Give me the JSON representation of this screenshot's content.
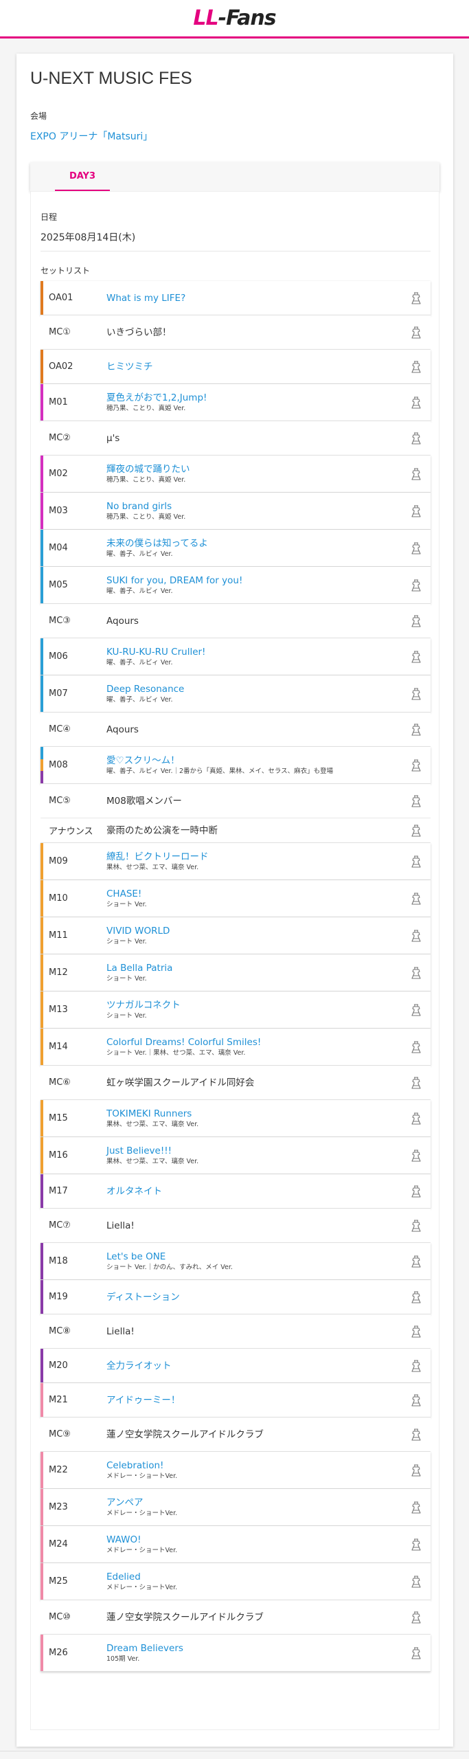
{
  "header": {
    "logo_ll": "LL",
    "logo_rest": "-Fans"
  },
  "event": {
    "title": "U-NEXT MUSIC FES",
    "venue_label": "会場",
    "venue": "EXPO アリーナ「Matsuri」"
  },
  "tabs": [
    {
      "label": "DAY3",
      "active": true
    }
  ],
  "day": {
    "date_label": "日程",
    "date": "2025年08月14日(木)",
    "setlist_label": "セットリスト"
  },
  "colors": {
    "orange": "#e07a1f",
    "magenta": "#d42fbf",
    "blue": "#2a9fd6",
    "amber": "#f0a030",
    "purple": "#8a3aa8",
    "pink": "#f08aa8",
    "link": "#1e90d6",
    "accent": "#e4007f"
  },
  "setlist": [
    {
      "code": "OA01",
      "title": "What is my LIFE?",
      "note": "",
      "link": true,
      "bar": [
        "orange"
      ],
      "h": 50
    },
    {
      "code": "MC①",
      "title": "いきづらい部！",
      "note": "",
      "link": false,
      "bar": [],
      "h": 50
    },
    {
      "code": "OA02",
      "title": "ヒミツミチ",
      "note": "",
      "link": true,
      "bar": [
        "orange"
      ],
      "h": 50
    },
    {
      "code": "M01",
      "title": "夏色えがおで1,2,Jump!",
      "note": "穂乃果、ことり、真姫 Ver.",
      "link": true,
      "bar": [
        "magenta"
      ],
      "h": 54
    },
    {
      "code": "MC②",
      "title": "μ's",
      "note": "",
      "link": false,
      "bar": [],
      "h": 50
    },
    {
      "code": "M02",
      "title": "輝夜の城で踊りたい",
      "note": "穂乃果、ことり、真姫 Ver.",
      "link": true,
      "bar": [
        "magenta"
      ],
      "h": 54
    },
    {
      "code": "M03",
      "title": "No brand girls",
      "note": "穂乃果、ことり、真姫 Ver.",
      "link": true,
      "bar": [
        "magenta"
      ],
      "h": 54
    },
    {
      "code": "M04",
      "title": "未来の僕らは知ってるよ",
      "note": "曜、善子、ルビィ Ver.",
      "link": true,
      "bar": [
        "blue"
      ],
      "h": 54
    },
    {
      "code": "M05",
      "title": "SUKI for you, DREAM for you!",
      "note": "曜、善子、ルビィ Ver.",
      "link": true,
      "bar": [
        "blue"
      ],
      "h": 54
    },
    {
      "code": "MC③",
      "title": "Aqours",
      "note": "",
      "link": false,
      "bar": [],
      "h": 50
    },
    {
      "code": "M06",
      "title": "KU-RU-KU-RU Cruller!",
      "note": "曜、善子、ルビィ Ver.",
      "link": true,
      "bar": [
        "blue"
      ],
      "h": 54
    },
    {
      "code": "M07",
      "title": "Deep Resonance",
      "note": "曜、善子、ルビィ Ver.",
      "link": true,
      "bar": [
        "blue"
      ],
      "h": 54
    },
    {
      "code": "MC④",
      "title": "Aqours",
      "note": "",
      "link": false,
      "bar": [],
      "h": 50
    },
    {
      "code": "M08",
      "title": "愛♡スクリ〜ム！",
      "note": "曜、善子、ルビィ Ver.｜2番から「真姫、果林、メイ、セラス、麻衣」も登場",
      "link": true,
      "bar": [
        "blue",
        "amber",
        "purple"
      ],
      "h": 54
    },
    {
      "code": "MC⑤",
      "title": "M08歌唱メンバー",
      "note": "",
      "link": false,
      "bar": [],
      "h": 50
    },
    {
      "code": "アナウンス",
      "title": "豪雨のため公演を一時中断",
      "note": "",
      "link": false,
      "bar": [],
      "h": 36
    },
    {
      "code": "M09",
      "title": "繚乱！ビクトリーロード",
      "note": "果林、せつ菜、エマ、璃奈 Ver.",
      "link": true,
      "bar": [
        "amber"
      ],
      "h": 54
    },
    {
      "code": "M10",
      "title": "CHASE!",
      "note": "ショート Ver.",
      "link": true,
      "bar": [
        "amber"
      ],
      "h": 54
    },
    {
      "code": "M11",
      "title": "VIVID WORLD",
      "note": "ショート Ver.",
      "link": true,
      "bar": [
        "amber"
      ],
      "h": 54
    },
    {
      "code": "M12",
      "title": "La Bella Patria",
      "note": "ショート Ver.",
      "link": true,
      "bar": [
        "amber"
      ],
      "h": 54
    },
    {
      "code": "M13",
      "title": "ツナガルコネクト",
      "note": "ショート Ver.",
      "link": true,
      "bar": [
        "amber"
      ],
      "h": 54
    },
    {
      "code": "M14",
      "title": "Colorful Dreams! Colorful Smiles!",
      "note": "ショート Ver.｜果林、せつ菜、エマ、璃奈 Ver.",
      "link": true,
      "bar": [
        "amber"
      ],
      "h": 54
    },
    {
      "code": "MC⑥",
      "title": "虹ヶ咲学園スクールアイドル同好会",
      "note": "",
      "link": false,
      "bar": [],
      "h": 50
    },
    {
      "code": "M15",
      "title": "TOKIMEKI Runners",
      "note": "果林、せつ菜、エマ、璃奈 Ver.",
      "link": true,
      "bar": [
        "amber"
      ],
      "h": 54
    },
    {
      "code": "M16",
      "title": "Just Believe!!!",
      "note": "果林、せつ菜、エマ、璃奈 Ver.",
      "link": true,
      "bar": [
        "amber"
      ],
      "h": 54
    },
    {
      "code": "M17",
      "title": "オルタネイト",
      "note": "",
      "link": true,
      "bar": [
        "purple"
      ],
      "h": 50
    },
    {
      "code": "MC⑦",
      "title": "Liella!",
      "note": "",
      "link": false,
      "bar": [],
      "h": 50
    },
    {
      "code": "M18",
      "title": "Let's be ONE",
      "note": "ショート Ver.｜かのん、すみれ、メイ Ver.",
      "link": true,
      "bar": [
        "purple"
      ],
      "h": 54
    },
    {
      "code": "M19",
      "title": "ディストーション",
      "note": "",
      "link": true,
      "bar": [
        "purple"
      ],
      "h": 50
    },
    {
      "code": "MC⑧",
      "title": "Liella!",
      "note": "",
      "link": false,
      "bar": [],
      "h": 50
    },
    {
      "code": "M20",
      "title": "全力ライオット",
      "note": "",
      "link": true,
      "bar": [
        "purple"
      ],
      "h": 50
    },
    {
      "code": "M21",
      "title": "アイドゥーミー！",
      "note": "",
      "link": true,
      "bar": [
        "pink"
      ],
      "h": 50
    },
    {
      "code": "MC⑨",
      "title": "蓮ノ空女学院スクールアイドルクラブ",
      "note": "",
      "link": false,
      "bar": [],
      "h": 50
    },
    {
      "code": "M22",
      "title": "Celebration!",
      "note": "メドレー・ショートVer.",
      "link": true,
      "bar": [
        "pink"
      ],
      "h": 54
    },
    {
      "code": "M23",
      "title": "アンペア",
      "note": "メドレー・ショートVer.",
      "link": true,
      "bar": [
        "pink"
      ],
      "h": 54
    },
    {
      "code": "M24",
      "title": "WAWO!",
      "note": "メドレー・ショートVer.",
      "link": true,
      "bar": [
        "pink"
      ],
      "h": 54
    },
    {
      "code": "M25",
      "title": "Edelied",
      "note": "メドレー・ショートVer.",
      "link": true,
      "bar": [
        "pink"
      ],
      "h": 54
    },
    {
      "code": "MC⑩",
      "title": "蓮ノ空女学院スクールアイドルクラブ",
      "note": "",
      "link": false,
      "bar": [],
      "h": 50
    },
    {
      "code": "M26",
      "title": "Dream Believers",
      "note": "105期 Ver.",
      "link": true,
      "bar": [
        "pink"
      ],
      "h": 54
    }
  ]
}
